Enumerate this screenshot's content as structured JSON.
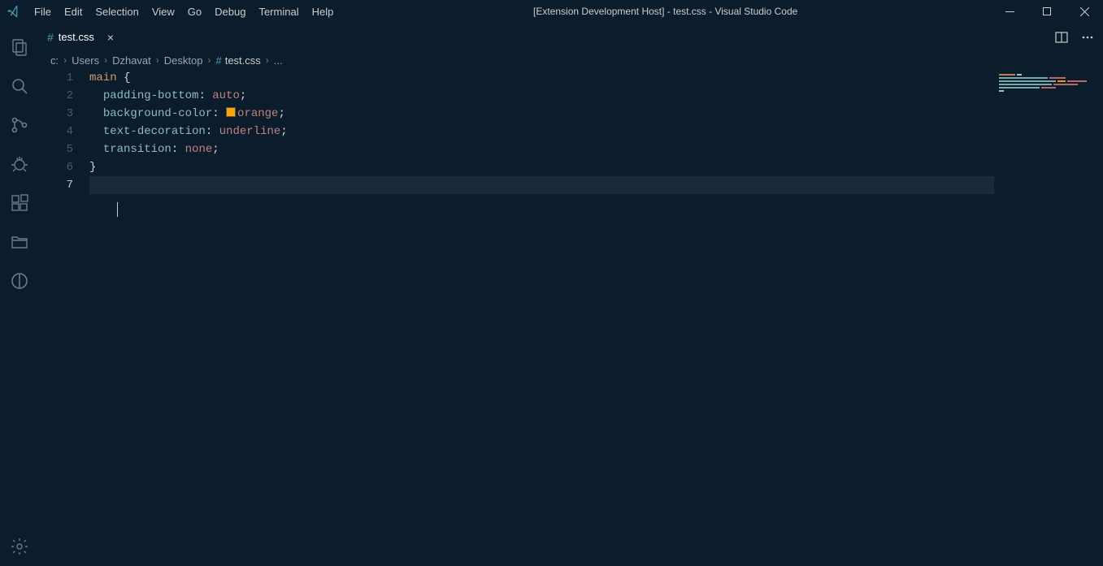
{
  "window": {
    "title": "[Extension Development Host] - test.css - Visual Studio Code"
  },
  "menu": [
    "File",
    "Edit",
    "Selection",
    "View",
    "Go",
    "Debug",
    "Terminal",
    "Help"
  ],
  "tab": {
    "label": "test.css",
    "icon": "css-file-icon"
  },
  "breadcrumbs": {
    "segments": [
      "c:",
      "Users",
      "Dzhavat",
      "Desktop"
    ],
    "file": "test.css",
    "tail": "..."
  },
  "code": {
    "lines": [
      {
        "n": 1,
        "type": "selector",
        "selector": "main",
        "open": "{"
      },
      {
        "n": 2,
        "type": "decl",
        "prop": "padding-bottom",
        "val": "auto",
        "swatch": null
      },
      {
        "n": 3,
        "type": "decl",
        "prop": "background-color",
        "val": "orange",
        "swatch": "#ffa500"
      },
      {
        "n": 4,
        "type": "decl",
        "prop": "text-decoration",
        "val": "underline",
        "swatch": null
      },
      {
        "n": 5,
        "type": "decl",
        "prop": "transition",
        "val": "none",
        "swatch": null
      },
      {
        "n": 6,
        "type": "close",
        "close": "}"
      },
      {
        "n": 7,
        "type": "empty"
      }
    ],
    "currentLine": 7,
    "cursor": {
      "line": 8,
      "col": 4
    }
  }
}
